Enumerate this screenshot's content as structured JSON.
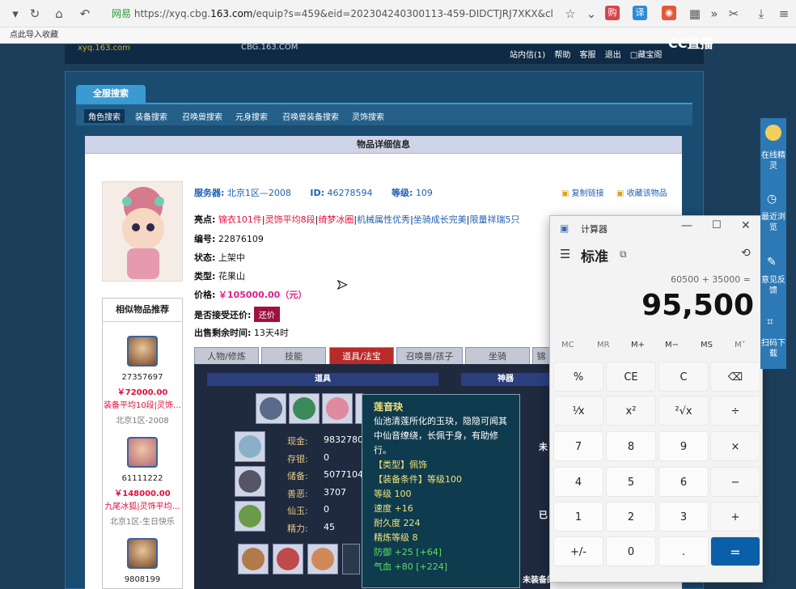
{
  "browser": {
    "url_secure": "网易",
    "url_prefix": "https://xyq.cbg.",
    "url_domain": "163.com",
    "url_rest": "/equip?s=459&eid=202304240300113-459-DIDCTJRJ7XKX&cl",
    "bookmark": "点此导入收藏",
    "brand": "CC直播"
  },
  "site": {
    "logo": "xyq.163.com",
    "logo2": "CBG.163.COM",
    "topnav": [
      "站内信(1)",
      "帮助",
      "客服",
      "退出",
      "□藏宝阁"
    ],
    "tab": "全服搜索",
    "subnav": [
      "角色搜索",
      "装备搜索",
      "召唤兽搜索",
      "元身搜索",
      "召唤兽装备搜索",
      "灵饰搜索"
    ],
    "detail_title": "物品详细信息"
  },
  "item": {
    "server_label": "服务器:",
    "server": "北京1区—2008",
    "id_label": "ID:",
    "id": "46278594",
    "level_label": "等级:",
    "level": "109",
    "copy_link": "复制链接",
    "collect": "收藏该物品",
    "highlight_label": "亮点:",
    "highlights": [
      "锦衣101件",
      "灵饰平均8段",
      "绮梦冰圈",
      "机械属性优秀",
      "坐骑成长完美",
      "限量祥瑞5只"
    ],
    "no_label": "编号:",
    "no": "22876109",
    "status_label": "状态:",
    "status": "上架中",
    "type_label": "类型:",
    "type": "花果山",
    "price_label": "价格:",
    "price": "￥105000.00（元）",
    "counter_label": "是否接受还价:",
    "counter_button": "还价",
    "remaining_label": "出售剩余时间:",
    "remaining": "13天4时"
  },
  "similar": {
    "title": "相似物品推荐",
    "items": [
      {
        "id": "27357697",
        "price": "￥72000.00",
        "tag": "装备平均10段|灵饰…",
        "server": "北京1区-2008"
      },
      {
        "id": "61111222",
        "price": "￥148000.00",
        "tag": "九尾冰狐|灵饰平均…",
        "server": "北京1区-生日快乐"
      },
      {
        "id": "9808199"
      }
    ]
  },
  "item_tabs": [
    "人物/修炼",
    "技能",
    "道具/法宝",
    "召唤兽/孩子",
    "坐骑",
    "锦"
  ],
  "game": {
    "bar_left": "道具",
    "bar_right": "神器",
    "stats": [
      {
        "label": "现金:",
        "value": "9832780"
      },
      {
        "label": "存银:",
        "value": "0"
      },
      {
        "label": "储备:",
        "value": "5077104"
      },
      {
        "label": "善恶:",
        "value": "3707"
      },
      {
        "label": "仙玉:",
        "value": "0"
      },
      {
        "label": "精力:",
        "value": "45"
      }
    ],
    "bottom_right": "未装备的所有法宝",
    "side_labels": [
      "未",
      "已"
    ]
  },
  "tooltip": {
    "title": "莲音玦",
    "desc": "仙池清莲所化的玉玦，隐隐可闻其中仙音缭绕，长佩于身，有助修行。",
    "type": "【类型】佩饰",
    "cond_label": "【装备条件】",
    "cond": "等级100",
    "lines": [
      "等级 100",
      "速度 +16",
      "耐久度 224",
      "精炼等级 8"
    ],
    "def": "防御 +25 [+64]",
    "hp": "气血 +80 [+224]"
  },
  "calculator": {
    "window_title": "计算器",
    "mode": "标准",
    "expression": "60500 + 35000 =",
    "result": "95,500",
    "memory": [
      "MC",
      "MR",
      "M+",
      "M−",
      "MS",
      "M˅"
    ],
    "keys": [
      "%",
      "CE",
      "C",
      "⌫",
      "⅟x",
      "x²",
      "²√x",
      "÷",
      "7",
      "8",
      "9",
      "×",
      "4",
      "5",
      "6",
      "−",
      "1",
      "2",
      "3",
      "+",
      "+/-",
      "0",
      ".",
      "="
    ]
  },
  "sidebar": [
    "在线精灵",
    "最近浏览",
    "意见反馈",
    "扫码下载"
  ]
}
